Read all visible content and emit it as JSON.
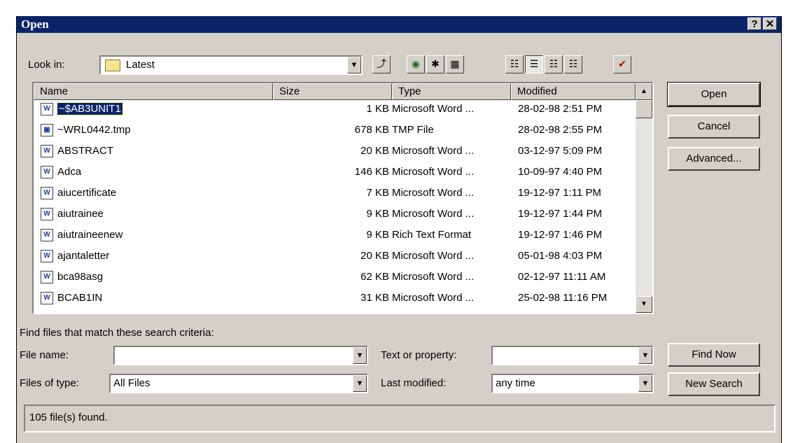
{
  "window": {
    "title": "Open",
    "help_label": "?",
    "close_label": "✕"
  },
  "look_in": {
    "label": "Look in:",
    "value": "Latest"
  },
  "toolbar": [
    "up-one-level",
    "search-web",
    "look-in-favorites",
    "add-to-favorites",
    "list-view",
    "details-view",
    "properties-view",
    "preview-view",
    "commands-and-settings"
  ],
  "columns": {
    "name": "Name",
    "size": "Size",
    "type": "Type",
    "modified": "Modified"
  },
  "files": [
    {
      "name": "~$AB3UNIT1",
      "size": "1 KB",
      "type": "Microsoft Word ...",
      "modified": "28-02-98 2:51 PM",
      "icon": "word-doc-icon",
      "selected": true
    },
    {
      "name": "~WRL0442.tmp",
      "size": "678 KB",
      "type": "TMP File",
      "modified": "28-02-98 2:55 PM",
      "icon": "tmp-file-icon",
      "selected": false
    },
    {
      "name": "ABSTRACT",
      "size": "20 KB",
      "type": "Microsoft Word ...",
      "modified": "03-12-97 5:09 PM",
      "icon": "word-doc-icon",
      "selected": false
    },
    {
      "name": "Adca",
      "size": "146 KB",
      "type": "Microsoft Word ...",
      "modified": "10-09-97 4:40 PM",
      "icon": "word-doc-icon",
      "selected": false
    },
    {
      "name": "aiucertificate",
      "size": "7 KB",
      "type": "Microsoft Word ...",
      "modified": "19-12-97 1:11 PM",
      "icon": "word-doc-icon",
      "selected": false
    },
    {
      "name": "aiutrainee",
      "size": "9 KB",
      "type": "Microsoft Word ...",
      "modified": "19-12-97 1:44 PM",
      "icon": "word-doc-icon",
      "selected": false
    },
    {
      "name": "aiutraineenew",
      "size": "9 KB",
      "type": "Rich Text Format",
      "modified": "19-12-97 1:46 PM",
      "icon": "word-doc-icon",
      "selected": false
    },
    {
      "name": "ajantaletter",
      "size": "20 KB",
      "type": "Microsoft Word ...",
      "modified": "05-01-98 4:03 PM",
      "icon": "word-doc-icon",
      "selected": false
    },
    {
      "name": "bca98asg",
      "size": "62 KB",
      "type": "Microsoft Word ...",
      "modified": "02-12-97 11:11 AM",
      "icon": "word-doc-icon",
      "selected": false
    },
    {
      "name": "BCAB1IN",
      "size": "31 KB",
      "type": "Microsoft Word ...",
      "modified": "25-02-98 11:16 PM",
      "icon": "word-doc-icon",
      "selected": false
    }
  ],
  "buttons": {
    "open": "Open",
    "cancel": "Cancel",
    "advanced": "Advanced...",
    "find_now": "Find Now",
    "new_search": "New Search"
  },
  "search": {
    "heading": "Find files that match these search criteria:",
    "file_name_label": "File name:",
    "file_name_value": "",
    "files_of_type_label": "Files of type:",
    "files_of_type_value": "All Files",
    "text_property_label": "Text or property:",
    "text_property_value": "",
    "last_modified_label": "Last modified:",
    "last_modified_value": "any time"
  },
  "status": {
    "text": "105 file(s) found."
  }
}
